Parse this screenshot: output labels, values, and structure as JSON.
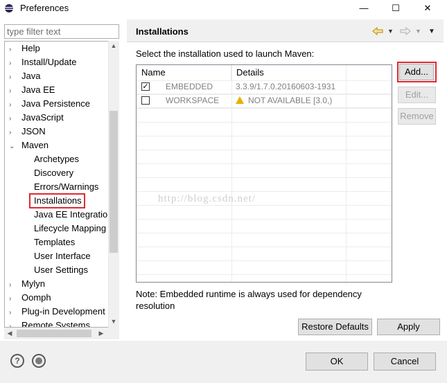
{
  "window": {
    "title": "Preferences",
    "minimize_glyph": "—",
    "maximize_glyph": "☐",
    "close_glyph": "✕"
  },
  "filter": {
    "placeholder": "type filter text"
  },
  "tree": {
    "items": [
      {
        "label": "Help",
        "arrow": "›"
      },
      {
        "label": "Install/Update",
        "arrow": "›"
      },
      {
        "label": "Java",
        "arrow": "›"
      },
      {
        "label": "Java EE",
        "arrow": "›"
      },
      {
        "label": "Java Persistence",
        "arrow": "›"
      },
      {
        "label": "JavaScript",
        "arrow": "›"
      },
      {
        "label": "JSON",
        "arrow": "›"
      },
      {
        "label": "Maven",
        "arrow": "⌄"
      },
      {
        "label": "Archetypes"
      },
      {
        "label": "Discovery"
      },
      {
        "label": "Errors/Warnings"
      },
      {
        "label": "Installations",
        "selected": true
      },
      {
        "label": "Java EE Integration"
      },
      {
        "label": "Lifecycle Mapping"
      },
      {
        "label": "Templates"
      },
      {
        "label": "User Interface"
      },
      {
        "label": "User Settings"
      },
      {
        "label": "Mylyn",
        "arrow": "›"
      },
      {
        "label": "Oomph",
        "arrow": "›"
      },
      {
        "label": "Plug-in Development",
        "arrow": "›"
      },
      {
        "label": "Remote Systems",
        "arrow": "›"
      }
    ]
  },
  "page": {
    "title": "Installations",
    "instruction": "Select the installation used to launch Maven:",
    "columns": [
      "Name",
      "Details"
    ],
    "rows": [
      {
        "checked": true,
        "name": "EMBEDDED",
        "details": "3.3.9/1.7.0.20160603-1931"
      },
      {
        "checked": false,
        "name": "WORKSPACE",
        "details": "NOT AVAILABLE [3.0,)",
        "warning": true
      }
    ],
    "buttons": {
      "add": "Add...",
      "edit": "Edit...",
      "remove": "Remove"
    },
    "note": "Note: Embedded runtime is always used for dependency resolution",
    "restore_defaults": "Restore Defaults",
    "apply": "Apply"
  },
  "watermark": "http://blog.csdn.net/",
  "footer": {
    "ok": "OK",
    "cancel": "Cancel",
    "help_glyph": "?"
  },
  "icons": {
    "back": "back-arrow-icon",
    "forward": "forward-arrow-icon",
    "menu": "view-menu-icon",
    "help": "help-icon",
    "record": "record-icon",
    "warning": "warning-icon"
  },
  "colors": {
    "highlight_border": "#e0282f",
    "warning": "#e8b000"
  }
}
